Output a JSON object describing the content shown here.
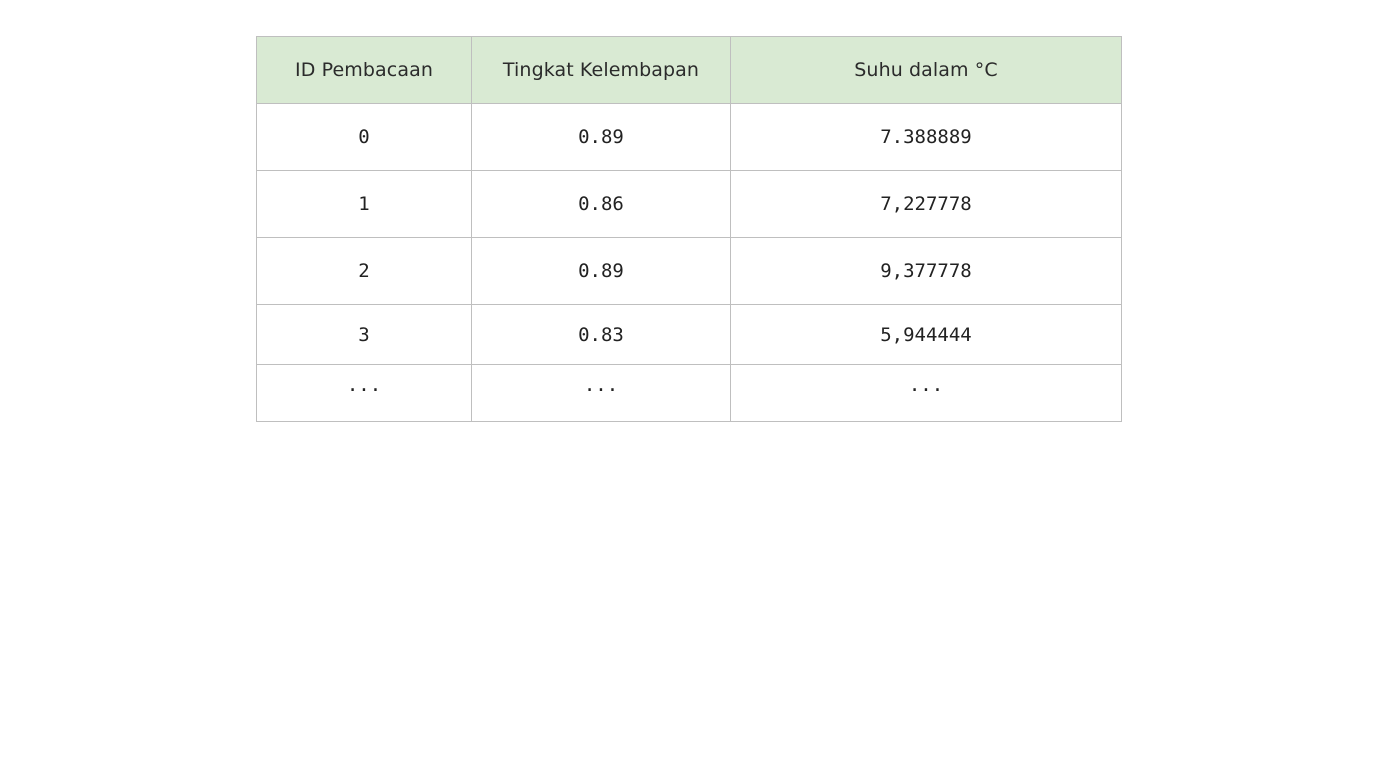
{
  "table": {
    "headers": [
      "ID Pembacaan",
      "Tingkat Kelembapan",
      "Suhu dalam °C"
    ],
    "rows": [
      [
        "0",
        "0.89",
        "7.388889"
      ],
      [
        "1",
        "0.86",
        "7,227778"
      ],
      [
        "2",
        "0.89",
        "9,377778"
      ],
      [
        "3",
        "0.83",
        "5,944444"
      ],
      [
        "...",
        "...",
        "..."
      ]
    ]
  },
  "colors": {
    "header_background": "#d9ead3",
    "border": "#bfbfbf",
    "text": "#222222"
  }
}
